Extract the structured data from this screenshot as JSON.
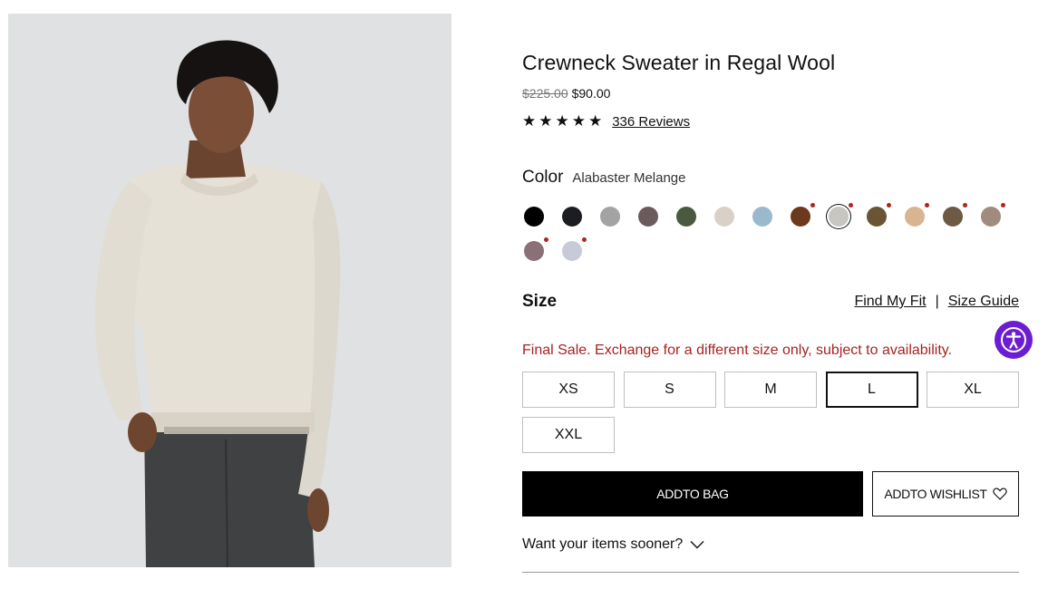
{
  "product": {
    "title": "Crewneck Sweater in Regal Wool",
    "original_price": "$225.00",
    "sale_price": "$90.00",
    "stars": "★★★★★",
    "reviews": "336 Reviews"
  },
  "color": {
    "label": "Color",
    "selected_name": "Alabaster Melange",
    "swatches": [
      {
        "hex": "#000000",
        "final_sale": false
      },
      {
        "hex": "#1b1d20",
        "final_sale": false
      },
      {
        "hex": "#a3a3a3",
        "final_sale": false
      },
      {
        "hex": "#6c5b5d",
        "final_sale": false
      },
      {
        "hex": "#4b5a3f",
        "final_sale": false
      },
      {
        "hex": "#d9d0c7",
        "final_sale": false
      },
      {
        "hex": "#9bb9cc",
        "final_sale": false
      },
      {
        "hex": "#6b3a1c",
        "final_sale": true
      },
      {
        "hex": "#c8c6c0",
        "final_sale": true,
        "selected": true
      },
      {
        "hex": "#6a5434",
        "final_sale": true
      },
      {
        "hex": "#d8b590",
        "final_sale": true
      },
      {
        "hex": "#6d5944",
        "final_sale": true
      },
      {
        "hex": "#a08b7c",
        "final_sale": true
      },
      {
        "hex": "#8a7077",
        "final_sale": true
      },
      {
        "hex": "#c8cad8",
        "final_sale": true
      }
    ]
  },
  "size": {
    "label": "Size",
    "find_my_fit": "Find My Fit",
    "separator": "|",
    "size_guide": "Size Guide",
    "final_sale_notice": "Final Sale. Exchange for a different size only, subject to availability.",
    "options": [
      "XS",
      "S",
      "M",
      "L",
      "XL",
      "XXL"
    ],
    "selected": "L"
  },
  "actions": {
    "add_to_bag": "ADDTO BAG",
    "add_to_wishlist": "ADDTO WISHLIST"
  },
  "delivery": {
    "sooner": "Want your items sooner?"
  },
  "colors": {
    "accent_final_sale": "#a52420",
    "accessibility_button": "#6b1ed1"
  }
}
